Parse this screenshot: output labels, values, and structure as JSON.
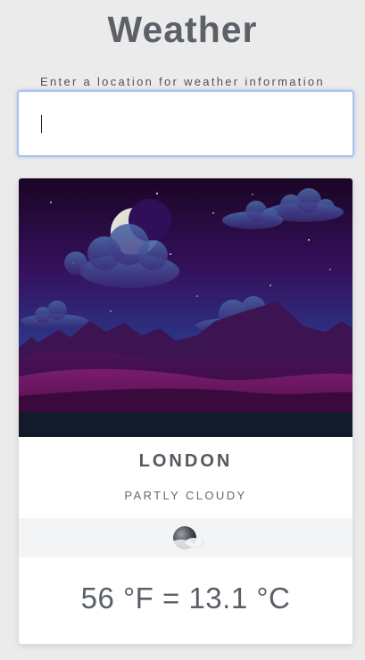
{
  "app": {
    "title": "Weather"
  },
  "search": {
    "prompt": "Enter a location for weather information",
    "value": "",
    "placeholder": ""
  },
  "weather": {
    "city": "LONDON",
    "condition": "PARTLY CLOUDY",
    "condition_icon": "partly-cloudy-night-icon",
    "temperature": "56 °F = 13.1 °C"
  },
  "scene": {
    "name": "night-mountain-illustration",
    "colors": {
      "sky_top": "#1a0524",
      "sky_mid": "#3b1466",
      "sky_bottom": "#1e4f9b",
      "ground": "#5a1456"
    }
  }
}
